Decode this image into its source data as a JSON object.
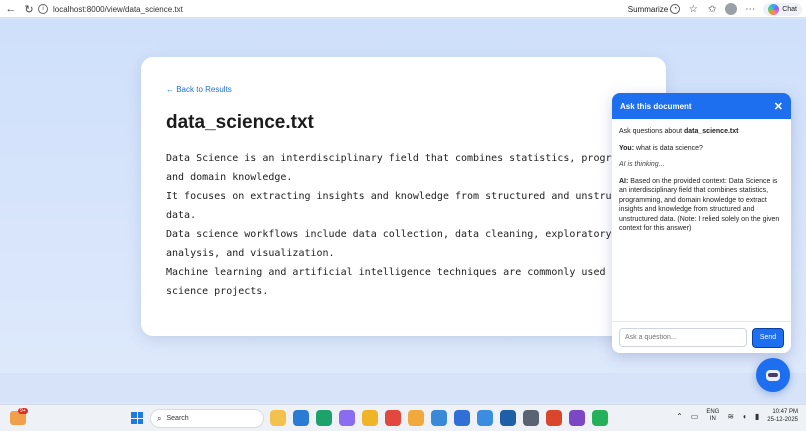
{
  "browser": {
    "url": "localhost:8000/view/data_science.txt",
    "summarize_label": "Summarize",
    "chat_label": "Chat"
  },
  "document": {
    "back_link": "← Back to Results",
    "title": "data_science.txt",
    "content": "Data Science is an interdisciplinary field that combines statistics, programming,\nand domain knowledge.\nIt focuses on extracting insights and knowledge from structured and unstructured\ndata.\nData science workflows include data collection, data cleaning, exploratory\nanalysis, and visualization.\nMachine learning and artificial intelligence techniques are commonly used in data\nscience projects."
  },
  "chat_panel": {
    "title": "Ask this document",
    "close_icon": "close-icon",
    "intro_prefix": "Ask questions about ",
    "intro_doc": "data_science.txt",
    "user_label": "You:",
    "user_message": " what is data science?",
    "thinking": "AI is thinking...",
    "ai_label": "AI:",
    "ai_message": " Based on the provided context: Data Science is an interdisciplinary field that combines statistics, programming, and domain knowledge to extract insights and knowledge from structured and unstructured data. (Note: I relied solely on the given context for this answer)",
    "input_placeholder": "Ask a question...",
    "send_label": "Send"
  },
  "taskbar": {
    "notification_count": "9+",
    "search_placeholder": "Search",
    "lang_top": "ENG",
    "lang_bottom": "IN",
    "time": "10:47 PM",
    "date": "25-12-2025"
  },
  "colors": {
    "accent": "#1e6ef0",
    "link": "#1f6fde",
    "page_bg": "#d6e4fa"
  }
}
